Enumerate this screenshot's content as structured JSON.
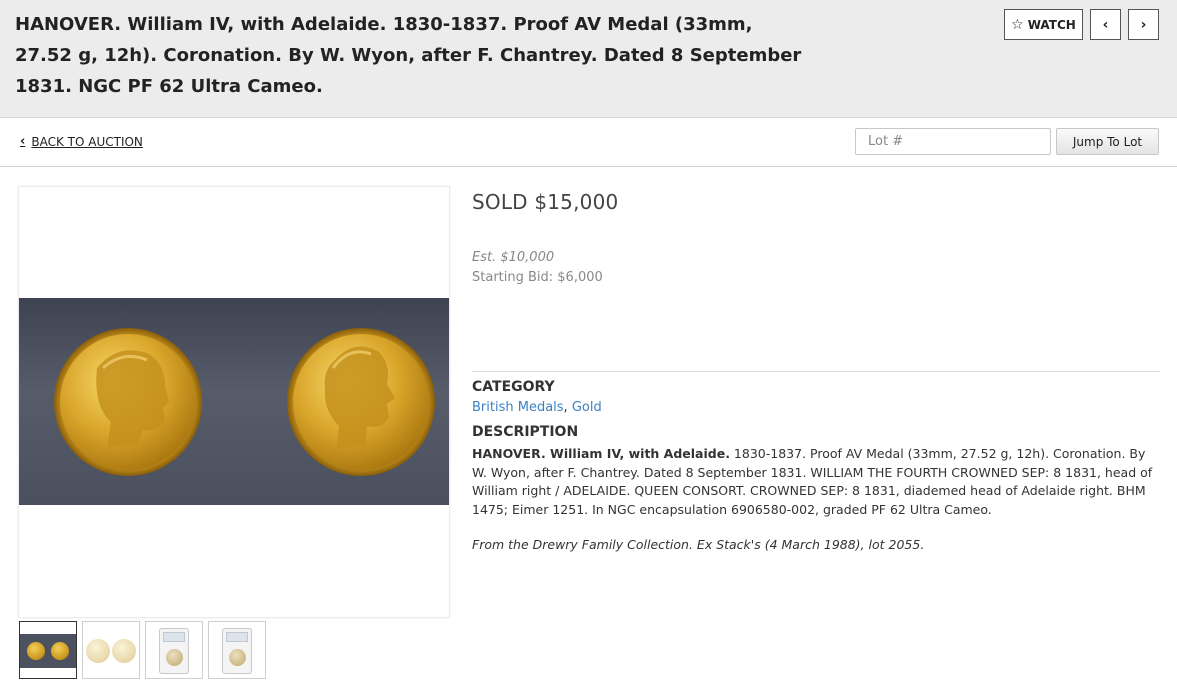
{
  "header": {
    "title": "HANOVER. William IV, with Adelaide. 1830-1837. Proof AV Medal (33mm, 27.52 g, 12h). Coronation. By W. Wyon, after F. Chantrey. Dated 8 September 1831. NGC PF 62 Ultra Cameo.",
    "watch_label": "WATCH",
    "watch_icon": "star-outline-icon",
    "prev_icon": "chevron-left-icon",
    "next_icon": "chevron-right-icon"
  },
  "subnav": {
    "back_label": "BACK TO AUCTION",
    "lot_placeholder": "Lot #",
    "jump_label": "Jump To Lot"
  },
  "gallery": {
    "main_alt": "Gold medal obverse and reverse",
    "thumbnails": [
      "obverse-reverse-dark",
      "obverse-reverse-light",
      "slab-front",
      "slab-back"
    ],
    "active_index": 0,
    "colors": {
      "background_band": "#4b515e",
      "gold": "#d4a429"
    }
  },
  "lot": {
    "sold_text": "SOLD $15,000",
    "estimate": "Est. $10,000",
    "starting_bid": "Starting Bid: $6,000",
    "category_heading": "CATEGORY",
    "categories": [
      "British Medals",
      "Gold"
    ],
    "category_separator": ", ",
    "description_heading": "DESCRIPTION",
    "description_lead": "HANOVER. William IV, with Adelaide.",
    "description_body": " 1830-1837. Proof AV Medal (33mm, 27.52 g, 12h). Coronation. By W. Wyon, after F. Chantrey. Dated 8 September 1831. WILLIAM THE FOURTH CROWNED SEP: 8 1831, head of William right / ADELAIDE. QUEEN CONSORT. CROWNED SEP: 8 1831, diademed head of Adelaide right. BHM 1475; Eimer 1251. In NGC encapsulation 6906580-002, graded PF 62 Ultra Cameo.",
    "provenance": "From the Drewry Family Collection. Ex Stack's (4 March 1988), lot 2055.",
    "link_color": "#3a82c4"
  }
}
